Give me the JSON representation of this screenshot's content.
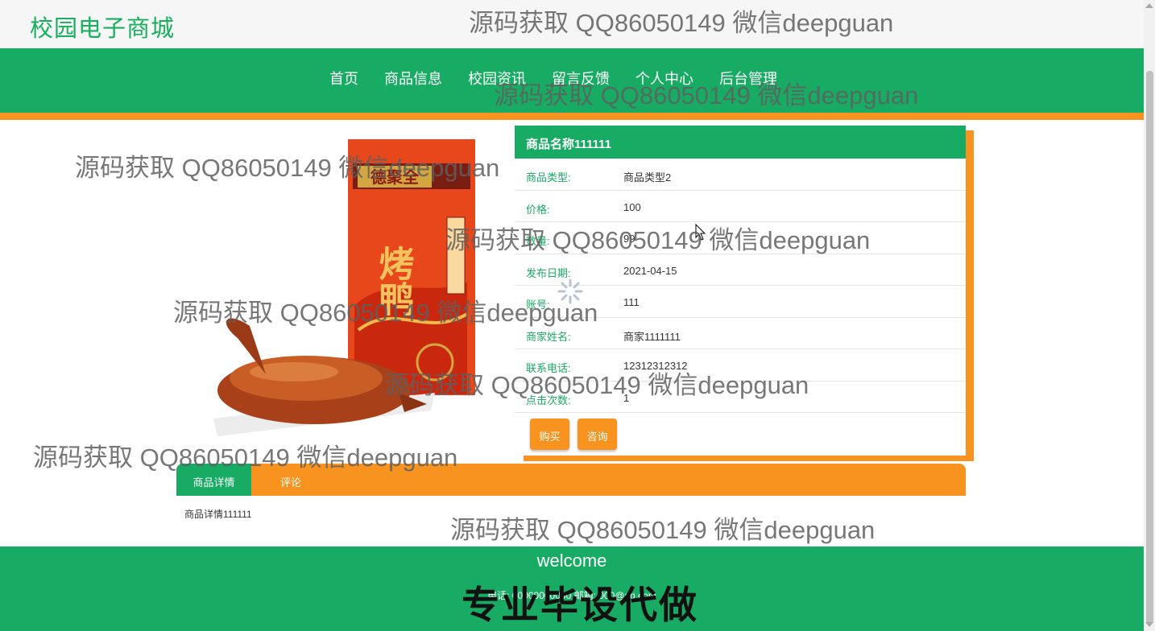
{
  "site": {
    "title": "校园电子商城"
  },
  "nav": {
    "items": [
      "首页",
      "商品信息",
      "校园资讯",
      "留言反馈",
      "个人中心",
      "后台管理"
    ]
  },
  "product": {
    "name": "商品名称111111",
    "fields": [
      {
        "label": "商品类型:",
        "value": "商品类型2"
      },
      {
        "label": "价格:",
        "value": "100"
      },
      {
        "label": "数量:",
        "value": "99"
      },
      {
        "label": "发布日期:",
        "value": "2021-04-15"
      },
      {
        "label": "账号:",
        "value": "111"
      },
      {
        "label": "商家姓名:",
        "value": "商家1111111"
      },
      {
        "label": "联系电话:",
        "value": "12312312312"
      },
      {
        "label": "点击次数:",
        "value": "1"
      }
    ],
    "buy_label": "购买",
    "consult_label": "咨询",
    "image_box_text": "德聚全",
    "image_title": "烤鸭"
  },
  "tabs": {
    "details_label": "商品详情",
    "comments_label": "评论"
  },
  "details": {
    "text": "商品详情111111"
  },
  "footer": {
    "welcome": "welcome",
    "contact": "电话: 00000000000 邮箱: 000@qq.com"
  },
  "watermark": {
    "text": "源码获取 QQ86050149 微信deepguan",
    "promo": "专业毕设代做"
  },
  "colors": {
    "primary": "#17ab63",
    "accent": "#f7931e"
  }
}
